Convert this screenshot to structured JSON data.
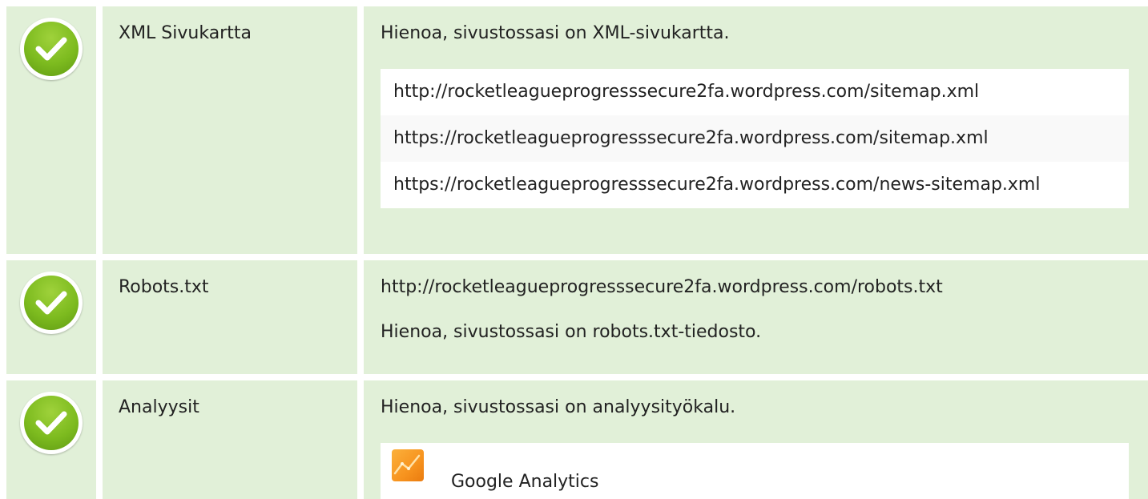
{
  "rows": [
    {
      "name": "XML Sivukartta",
      "status": "pass",
      "message": "Hienoa, sivustossasi on XML-sivukartta.",
      "urls": [
        "http://rocketleagueprogresssecure2fa.wordpress.com/sitemap.xml",
        "https://rocketleagueprogresssecure2fa.wordpress.com/sitemap.xml",
        "https://rocketleagueprogresssecure2fa.wordpress.com/news-sitemap.xml"
      ]
    },
    {
      "name": "Robots.txt",
      "status": "pass",
      "url": "http://rocketleagueprogresssecure2fa.wordpress.com/robots.txt",
      "message": "Hienoa, sivustossasi on robots.txt-tiedosto."
    },
    {
      "name": "Analyysit",
      "status": "pass",
      "message": "Hienoa, sivustossasi on analyysityökalu.",
      "tools": [
        {
          "name": "Google Analytics",
          "icon": "google-analytics-icon"
        }
      ]
    }
  ],
  "icons": {
    "status": "check-circle-icon"
  },
  "colors": {
    "row_background": "#e1f0d8",
    "pass_green": "#7dbb1f",
    "analytics_orange": "#f7931e"
  }
}
